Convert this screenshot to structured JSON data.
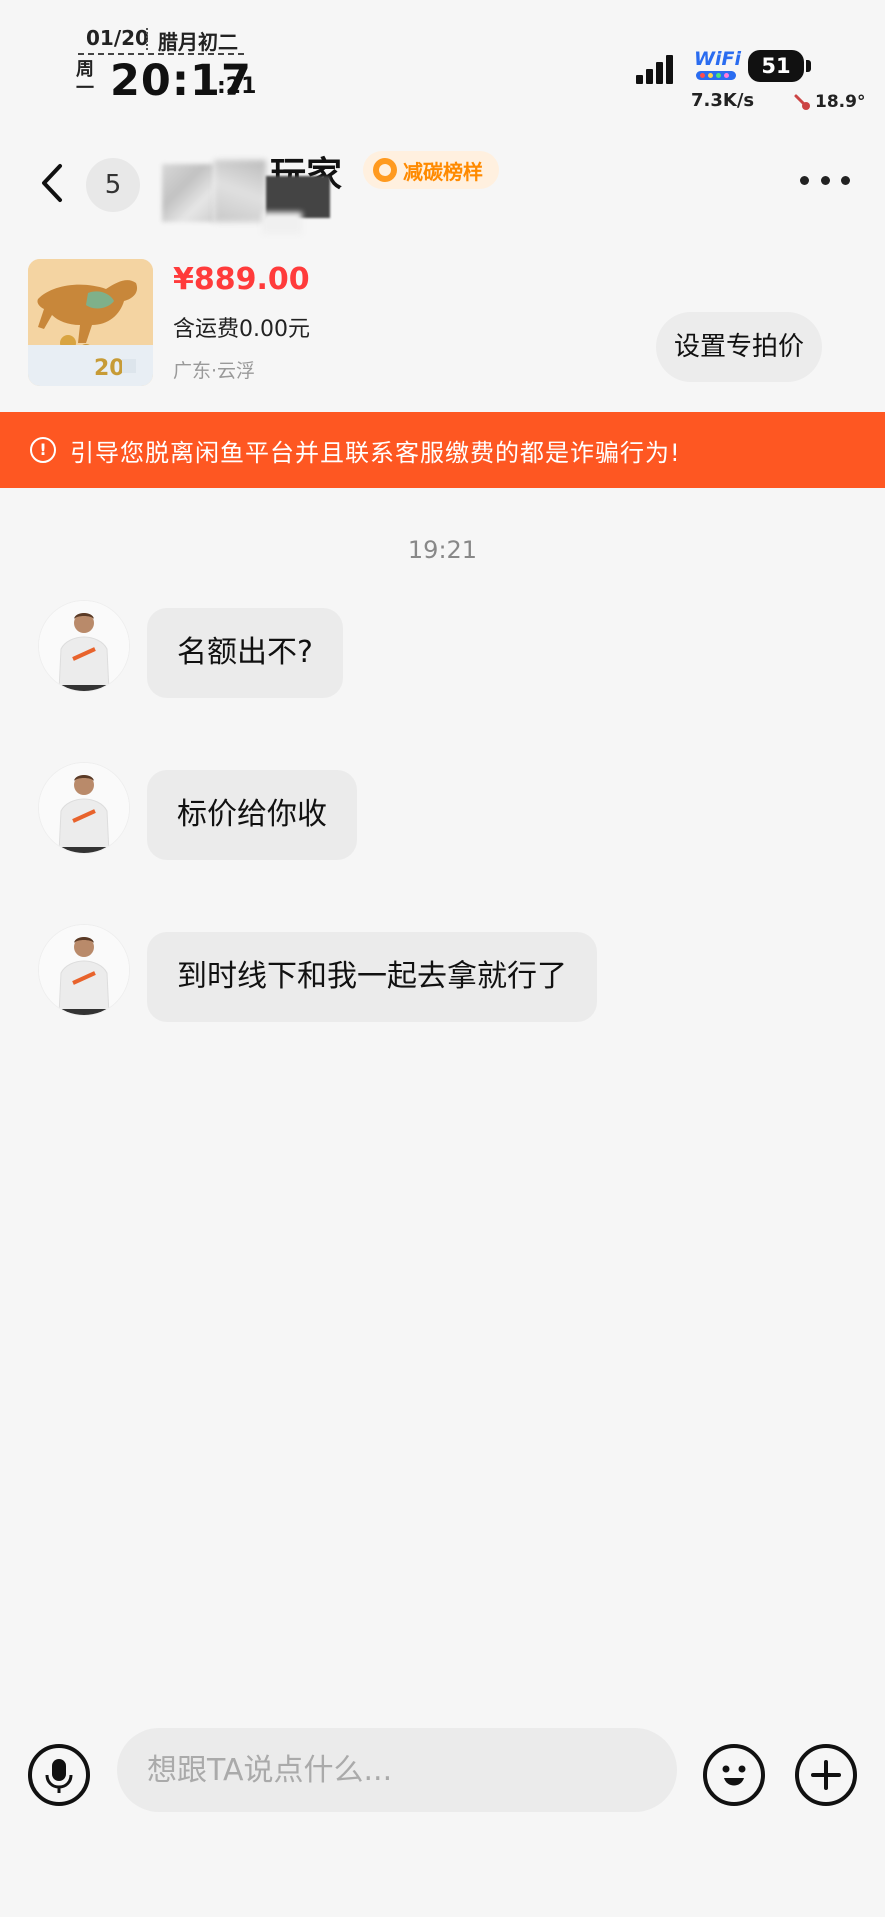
{
  "status_bar": {
    "date": "01/20",
    "lunar_date": "腊月初二",
    "weekday": "周一",
    "time": "20:17",
    "seconds": ":21",
    "wifi_label": "WiFi",
    "battery": "51",
    "net_speed": "7.3K/s",
    "temperature": "18.9°"
  },
  "header": {
    "unread_count": "5",
    "title_visible": "玩家",
    "tag_label": "减碳榜样"
  },
  "product": {
    "price": "¥889.00",
    "shipping": "含运费0.00元",
    "location": "广东·云浮",
    "special_price_button": "设置专拍价",
    "image_text": "20"
  },
  "warning": {
    "icon_glyph": "!",
    "text": "引导您脱离闲鱼平台并且联系客服缴费的都是诈骗行为!"
  },
  "chat": {
    "timestamp": "19:21",
    "messages": [
      {
        "text": "名额出不?"
      },
      {
        "text": "标价给你收"
      },
      {
        "text": "到时线下和我一起去拿就行了"
      }
    ]
  },
  "input_bar": {
    "placeholder": "想跟TA说点什么..."
  },
  "colors": {
    "accent_orange": "#fe5722",
    "price_red": "#ff3b3b",
    "tag_orange": "#ff8a00",
    "wifi_blue": "#2a6cf0"
  },
  "icons": [
    "signal-icon",
    "wifi-icon",
    "battery-icon",
    "thermometer-icon",
    "back-arrow-icon",
    "more-icon",
    "warning-icon",
    "mic-icon",
    "emoji-icon",
    "plus-icon"
  ]
}
